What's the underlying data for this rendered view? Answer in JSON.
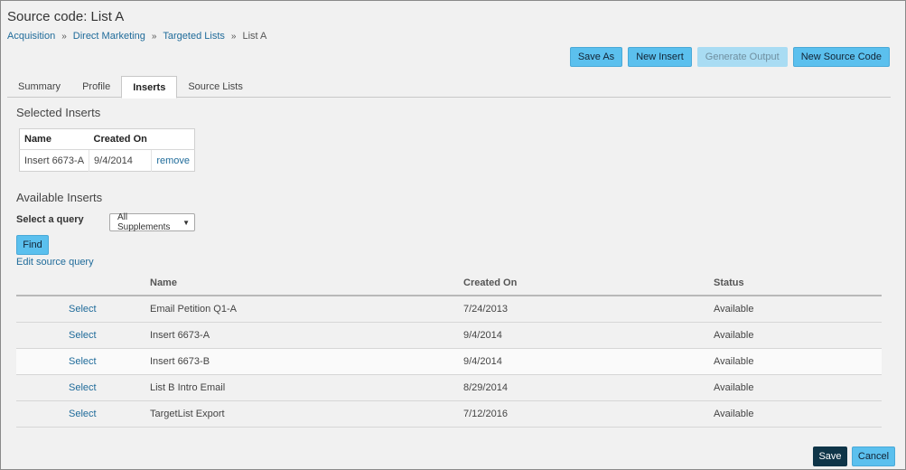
{
  "page_title": "Source code: List A",
  "breadcrumb": {
    "items": [
      "Acquisition",
      "Direct Marketing",
      "Targeted Lists"
    ],
    "current": "List A",
    "separator": "»"
  },
  "actions": {
    "save_as": "Save As",
    "new_insert": "New Insert",
    "generate_output": "Generate Output",
    "new_source_code": "New Source Code"
  },
  "tabs": [
    "Summary",
    "Profile",
    "Inserts",
    "Source Lists"
  ],
  "active_tab": "Inserts",
  "selected_inserts": {
    "title": "Selected Inserts",
    "headers": [
      "Name",
      "Created On"
    ],
    "rows": [
      {
        "name": "Insert 6673-A",
        "created": "9/4/2014",
        "action": "remove"
      }
    ]
  },
  "available_inserts": {
    "title": "Available Inserts",
    "query_label": "Select a query",
    "query_value": "All Supplements",
    "find_label": "Find",
    "edit_link": "Edit source query",
    "headers": [
      "Name",
      "Created On",
      "Status"
    ],
    "rows": [
      {
        "action": "Select",
        "name": "Email Petition Q1-A",
        "created": "7/24/2013",
        "status": "Available"
      },
      {
        "action": "Select",
        "name": "Insert 6673-A",
        "created": "9/4/2014",
        "status": "Available"
      },
      {
        "action": "Select",
        "name": "Insert 6673-B",
        "created": "9/4/2014",
        "status": "Available"
      },
      {
        "action": "Select",
        "name": "List B Intro Email",
        "created": "8/29/2014",
        "status": "Available"
      },
      {
        "action": "Select",
        "name": "TargetList Export",
        "created": "7/12/2016",
        "status": "Available"
      }
    ]
  },
  "footer": {
    "save": "Save",
    "cancel": "Cancel"
  },
  "colors": {
    "accent": "#5bc0ee",
    "link": "#1f6b9a",
    "primary_dark": "#0f3548"
  }
}
